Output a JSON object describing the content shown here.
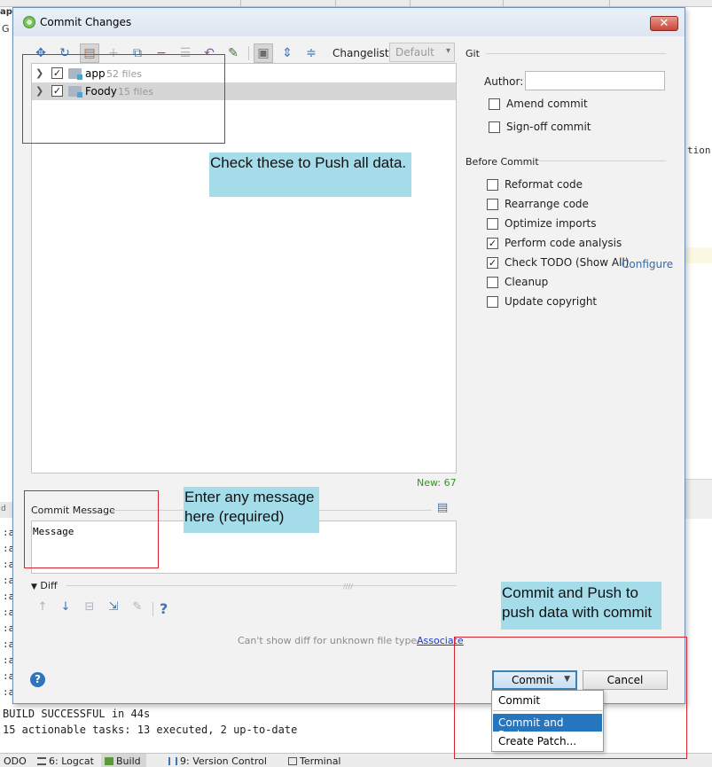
{
  "background": {
    "left_tab": "ap",
    "left_letter": "G",
    "right_snippet": "tion",
    "left_console_lines": [
      ":a",
      ":a",
      ":a",
      ":a",
      ":a",
      ":a",
      ":a",
      ":a",
      ":a",
      ":a",
      ":a"
    ],
    "console": [
      "BUILD SUCCESSFUL in 44s",
      "15 actionable tasks: 13 executed, 2 up-to-date"
    ],
    "status_tabs": [
      {
        "label": "ODO"
      },
      {
        "label": "6: Logcat"
      },
      {
        "label": "Build"
      },
      {
        "label": "9: Version Control"
      },
      {
        "label": "Terminal"
      }
    ]
  },
  "dialog": {
    "title": "Commit Changes",
    "close_glyph": "✕",
    "toolbar": {
      "icons": [
        "move-icon",
        "refresh-icon",
        "diff-icon",
        "add-icon",
        "jump-to-source-icon",
        "delete-icon",
        "group-icon",
        "revert-icon",
        "edit-icon",
        "view-options-icon",
        "expand-all-icon",
        "collapse-all-icon"
      ],
      "changelist_label": "Changelist:",
      "changelist_value": "Default"
    },
    "tree": [
      {
        "name": "app",
        "count": "52 files",
        "checked": true
      },
      {
        "name": "Foody",
        "count": "15 files",
        "checked": true
      }
    ],
    "new_count": "New: 67",
    "commit_message_label": "Commit Message",
    "commit_message_value": "Message",
    "diff_label": "Diff",
    "diff_help": "?",
    "cant_show": "Can't show diff for unknown file type.",
    "associate_link": "Associate",
    "help": "?",
    "commit_button": "Commit",
    "cancel_button": "Cancel"
  },
  "git_panel": {
    "title": "Git",
    "author_label": "Author:",
    "author_value": "",
    "amend": "Amend commit",
    "signoff": "Sign-off commit",
    "before_commit_title": "Before Commit",
    "options": [
      {
        "label": "Reformat code",
        "checked": false
      },
      {
        "label": "Rearrange code",
        "checked": false
      },
      {
        "label": "Optimize imports",
        "checked": false
      },
      {
        "label": "Perform code analysis",
        "checked": true
      },
      {
        "label": "Check TODO (Show All)",
        "checked": true
      },
      {
        "label": "Cleanup",
        "checked": false
      },
      {
        "label": "Update copyright",
        "checked": false
      }
    ],
    "configure_link": "Configure"
  },
  "commit_menu": [
    {
      "label": "Commit"
    },
    {
      "label": "Commit and Push..."
    },
    {
      "label": "Create Patch..."
    }
  ],
  "annotations": {
    "tree_note": "Check these to Push all data.",
    "message_note": "Enter any message here (required)",
    "push_note": "Commit and Push to push data with commit"
  },
  "colors": {
    "annotation_fill": "#a4dcea",
    "annotation_border": "#d8222e",
    "menu_highlight": "#2675bf",
    "link": "#1a39c8"
  }
}
